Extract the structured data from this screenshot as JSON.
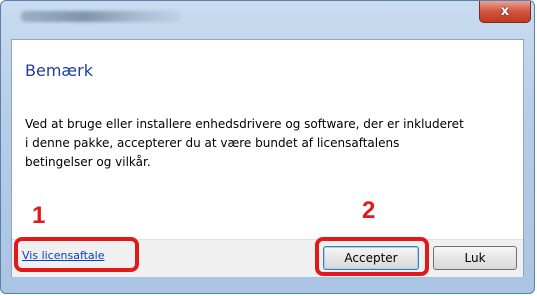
{
  "dialog": {
    "close_glyph": "x",
    "heading": "Bemærk",
    "message_lines": [
      "Ved at bruge eller installere enhedsdrivere og software, der er inkluderet",
      "i denne pakke, accepterer du at være bundet af licensaftalens",
      "betingelser og vilkår."
    ],
    "license_link": "Vis licensaftale",
    "accept_label": "Accepter",
    "close_label": "Luk"
  },
  "annotations": {
    "step1": "1",
    "step2": "2",
    "callout_color": "#e31818"
  },
  "icons": {
    "close": "close-icon"
  }
}
